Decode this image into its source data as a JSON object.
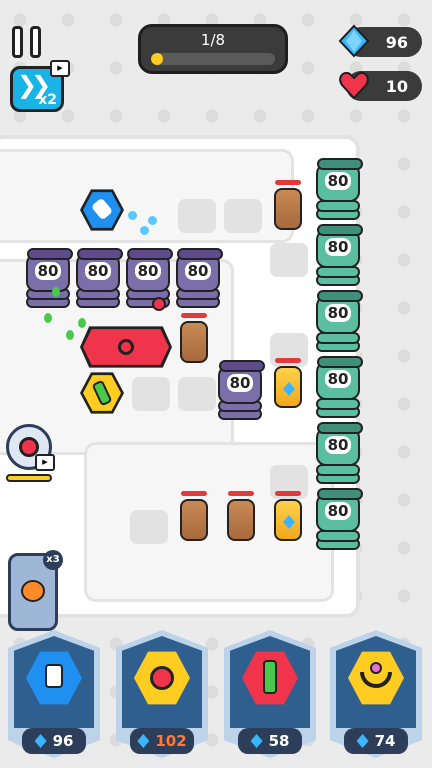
{
  "hud": {
    "wave_label": "1/8",
    "wave_progress": 0.1,
    "speed_multiplier": "x2",
    "gems": "96",
    "lives": "10",
    "speed_icon": "fast-forward-icon",
    "video_icon": "tv-ad-icon"
  },
  "enemies": {
    "hp_values": [
      "80",
      "80",
      "80",
      "80",
      "80",
      "80",
      "80",
      "80",
      "80",
      "80",
      "80"
    ]
  },
  "powerup": {
    "count": "x3"
  },
  "shop": {
    "items": [
      {
        "name": "blue-cannon",
        "price": "96",
        "affordable": true
      },
      {
        "name": "orange-turret",
        "price": "102",
        "affordable": false
      },
      {
        "name": "red-launcher",
        "price": "58",
        "affordable": true
      },
      {
        "name": "yellow-ring-tower",
        "price": "74",
        "affordable": true
      }
    ]
  },
  "colors": {
    "gem": "#3ab6ff",
    "heart": "#f0344b",
    "gold": "#ffcc22",
    "accent_blue": "#19b3e6"
  }
}
